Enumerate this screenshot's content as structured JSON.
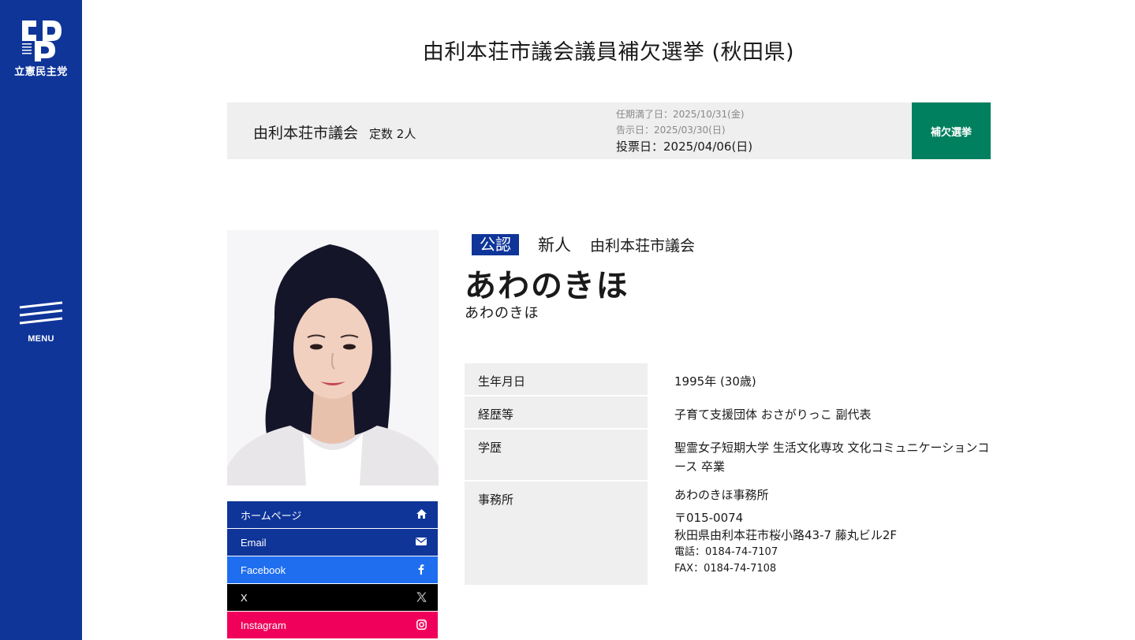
{
  "sidebar": {
    "logo_text": "立憲民主党",
    "logo_letters": "CDP",
    "menu_label": "MENU"
  },
  "page": {
    "title": "由利本荘市議会議員補欠選挙 (秋田県)"
  },
  "election": {
    "council": "由利本荘市議会",
    "seats": "定数 2人",
    "term_end": "任期満了日：2025/10/31(金)",
    "announce": "告示日：2025/03/30(日)",
    "vote": "投票日：2025/04/06(日)",
    "type": "補欠選挙",
    "type_color": "#00805f"
  },
  "candidate": {
    "badge": "公認",
    "status": "新人",
    "council": "由利本荘市議会",
    "name": "あわのきほ",
    "kana": "あわのきほ"
  },
  "profile": [
    {
      "label": "生年月日",
      "value": "1995年 (30歳)"
    },
    {
      "label": "経歴等",
      "value": "子育て支援団体 おさがりっこ 副代表"
    },
    {
      "label": "学歴",
      "value": "聖霊女子短期大学 生活文化専攻 文化コミュニケーションコース 卒業"
    },
    {
      "label": "事務所"
    }
  ],
  "office": {
    "name": "あわのきほ事務所",
    "zip": "〒015-0074",
    "address": "秋田県由利本荘市桜小路43-7 藤丸ビル2F",
    "tel": "電話：0184-74-7107",
    "fax": "FAX：0184-74-7108"
  },
  "links": [
    {
      "label": "ホームページ",
      "icon": "home-icon",
      "color": "#0f3599"
    },
    {
      "label": "Email",
      "icon": "mail-icon",
      "color": "#0f3599"
    },
    {
      "label": "Facebook",
      "icon": "facebook-icon",
      "color": "#1f6ef0"
    },
    {
      "label": "X",
      "icon": "x-icon",
      "color": "#000000"
    },
    {
      "label": "Instagram",
      "icon": "instagram-icon",
      "color": "#f0005a"
    }
  ],
  "colors": {
    "brand": "#0f3599",
    "panel": "#efefef"
  }
}
